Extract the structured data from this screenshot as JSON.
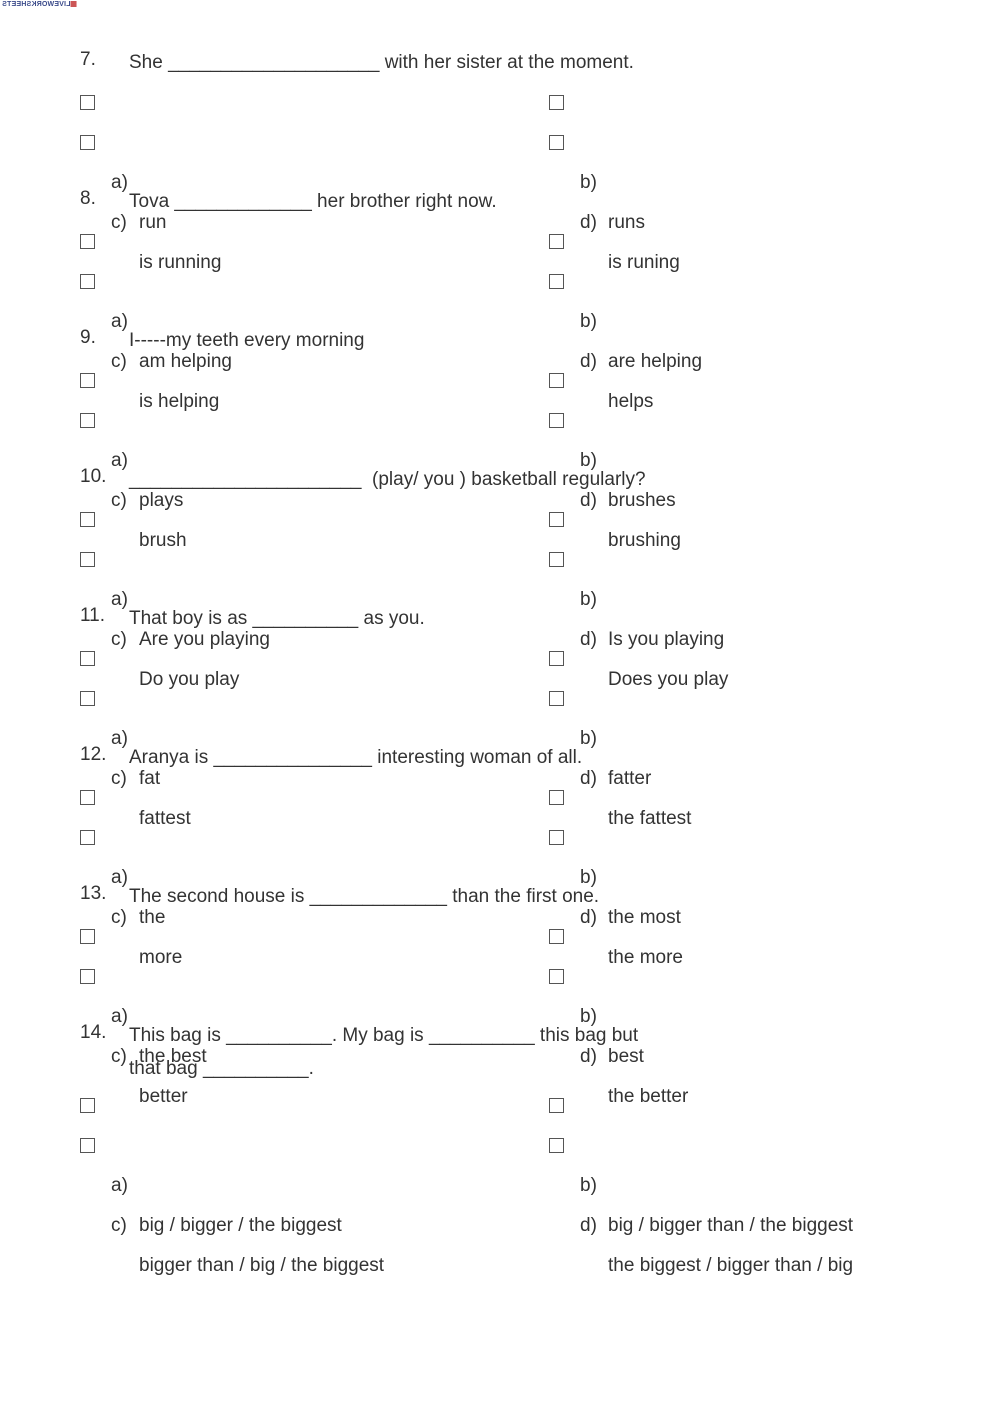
{
  "logo": "LIVEWORKSHEETS",
  "questions": [
    {
      "num": "7.",
      "lines": [
        "She ____________________ with her sister at the moment."
      ],
      "options": [
        {
          "letter": "a)",
          "text": "run"
        },
        {
          "letter": "b)",
          "text": "runs"
        },
        {
          "letter": "c)",
          "text": "is running"
        },
        {
          "letter": "d)",
          "text": "is runing"
        }
      ]
    },
    {
      "num": "8.",
      "lines": [
        "Tova _____________ her brother right now."
      ],
      "options": [
        {
          "letter": "a)",
          "text": "am helping"
        },
        {
          "letter": "b)",
          "text": "are helping"
        },
        {
          "letter": "c)",
          "text": "is helping"
        },
        {
          "letter": "d)",
          "text": "helps"
        }
      ]
    },
    {
      "num": "9.",
      "lines": [
        "I-----my teeth every morning"
      ],
      "options": [
        {
          "letter": "a)",
          "text": "plays"
        },
        {
          "letter": "b)",
          "text": "brushes"
        },
        {
          "letter": "c)",
          "text": "brush"
        },
        {
          "letter": "d)",
          "text": "brushing"
        }
      ]
    },
    {
      "num": "10.",
      "lines": [
        "______________________  (play/ you ) basketball regularly?"
      ],
      "options": [
        {
          "letter": "a)",
          "text": "Are you playing"
        },
        {
          "letter": "b)",
          "text": "Is you playing"
        },
        {
          "letter": "c)",
          "text": "Do you play"
        },
        {
          "letter": "d)",
          "text": "Does you play"
        }
      ]
    },
    {
      "num": "11.",
      "lines": [
        "That boy is as __________ as you."
      ],
      "options": [
        {
          "letter": "a)",
          "text": "fat"
        },
        {
          "letter": "b)",
          "text": "fatter"
        },
        {
          "letter": "c)",
          "text": "fattest"
        },
        {
          "letter": "d)",
          "text": "the fattest"
        }
      ]
    },
    {
      "num": "12.",
      "lines": [
        "Aranya is _______________ interesting woman of all."
      ],
      "options": [
        {
          "letter": "a)",
          "text": "the"
        },
        {
          "letter": "b)",
          "text": "the most"
        },
        {
          "letter": "c)",
          "text": "more"
        },
        {
          "letter": "d)",
          "text": "the more"
        }
      ]
    },
    {
      "num": "13.",
      "lines": [
        "The second house is _____________ than the first one."
      ],
      "options": [
        {
          "letter": "a)",
          "text": "the best"
        },
        {
          "letter": "b)",
          "text": "best"
        },
        {
          "letter": "c)",
          "text": "better"
        },
        {
          "letter": "d)",
          "text": "the better"
        }
      ]
    },
    {
      "num": "14.",
      "lines": [
        "This bag is __________. My bag is __________ this bag but",
        "that bag __________."
      ],
      "options": [
        {
          "letter": "a)",
          "text": "big / bigger / the biggest"
        },
        {
          "letter": "b)",
          "text": "big / bigger than / the biggest"
        },
        {
          "letter": "c)",
          "text": "bigger than / big / the biggest"
        },
        {
          "letter": "d)",
          "text": "the biggest / bigger than / big"
        }
      ]
    }
  ]
}
